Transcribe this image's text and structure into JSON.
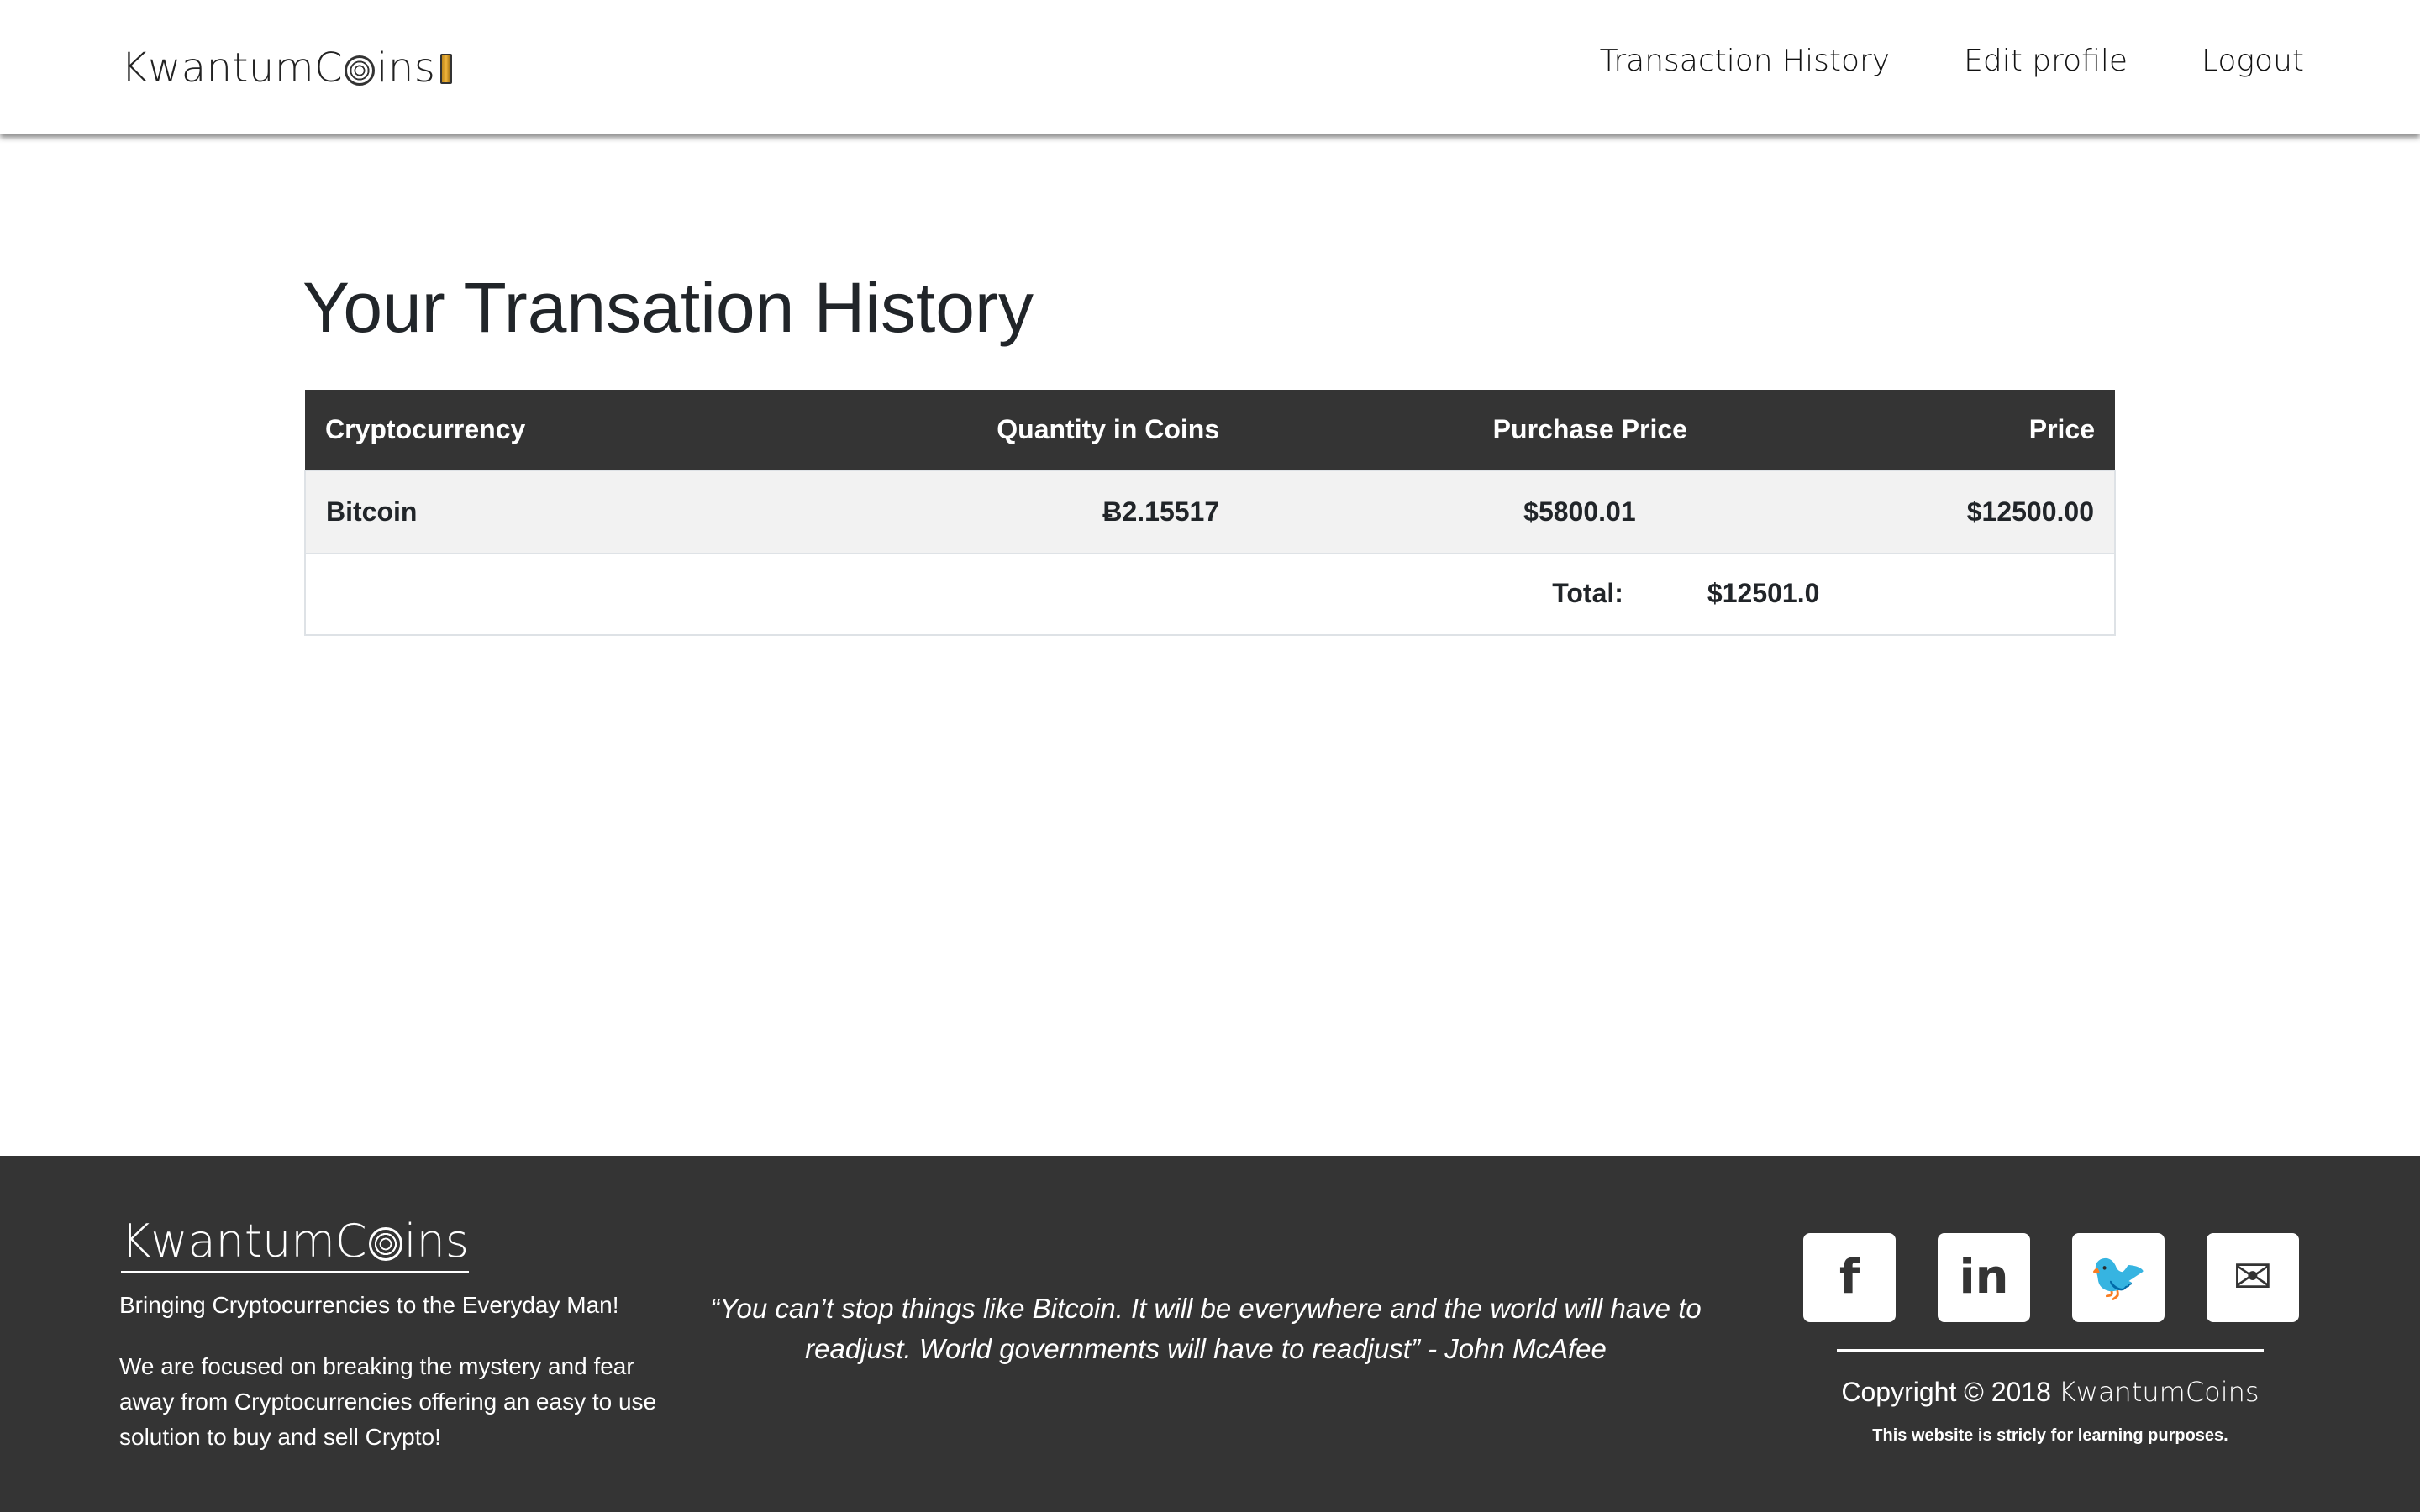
{
  "navbar": {
    "brand_prefix": "Kwantum",
    "brand_suffix": "ins",
    "links": {
      "history": "Transaction History",
      "edit_profile": "Edit profile",
      "logout": "Logout"
    }
  },
  "main": {
    "title": "Your Transation History",
    "table": {
      "headers": {
        "crypto": "Cryptocurrency",
        "quantity": "Quantity in Coins",
        "purchase_price": "Purchase Price",
        "price": "Price"
      },
      "rows": [
        {
          "crypto": "Bitcoin",
          "quantity": "Ƀ2.15517",
          "purchase_price": "$5800.01",
          "price": "$12500.00"
        }
      ],
      "total_label": "Total:",
      "total_value": "$12501.0"
    }
  },
  "footer": {
    "brand_prefix": "Kwantum",
    "brand_suffix": "ins",
    "tagline": "Bringing Cryptocurrencies to the Everyday Man!",
    "about": "We are focused on breaking the mystery and fear away from Cryptocurrencies offering an easy to use solution to buy and sell Crypto!",
    "quote": "“You can’t stop things like Bitcoin. It will be everywhere and the world will have to readjust. World governments will have to readjust” - John McAfee",
    "social": {
      "facebook_glyph": "f",
      "linkedin_glyph": "in",
      "twitter_glyph": "🐦",
      "email_glyph": "✉"
    },
    "copyright_text": "Copyright © 2018",
    "copyright_brand": "KwantumCoins",
    "disclaimer": "This website is stricly for learning purposes."
  },
  "icons": {
    "menu_toggle": "menu-toggle-icon",
    "facebook": "facebook-icon",
    "linkedin": "linkedin-icon",
    "twitter": "twitter-icon",
    "email": "email-icon"
  },
  "colors": {
    "dark": "#343434",
    "white": "#ffffff",
    "accent_toggle": "#f0b43a"
  }
}
